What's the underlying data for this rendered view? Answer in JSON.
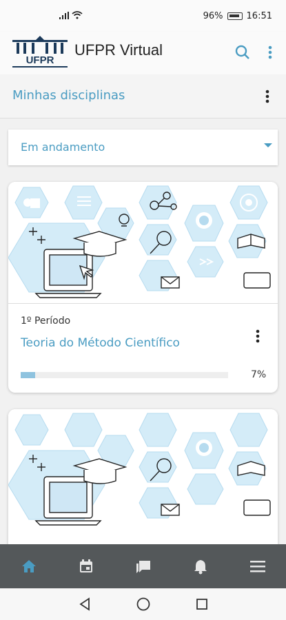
{
  "status": {
    "battery": "96%",
    "time": "16:51"
  },
  "app": {
    "logo_text": "UFPR",
    "title": "UFPR Virtual"
  },
  "header": {
    "section_title": "Minhas disciplinas"
  },
  "filter": {
    "selected": "Em andamento"
  },
  "courses": [
    {
      "period": "1º Período",
      "name": "Teoria do Método Científico",
      "progress": 7,
      "progress_label": "7%"
    }
  ],
  "colors": {
    "accent": "#4a9cc2",
    "bottom_nav": "#54585a",
    "hex_light": "#d4ecf8"
  },
  "nav": {
    "items": [
      "home-icon",
      "calendar-icon",
      "forum-icon",
      "bell-icon",
      "menu-icon"
    ]
  }
}
